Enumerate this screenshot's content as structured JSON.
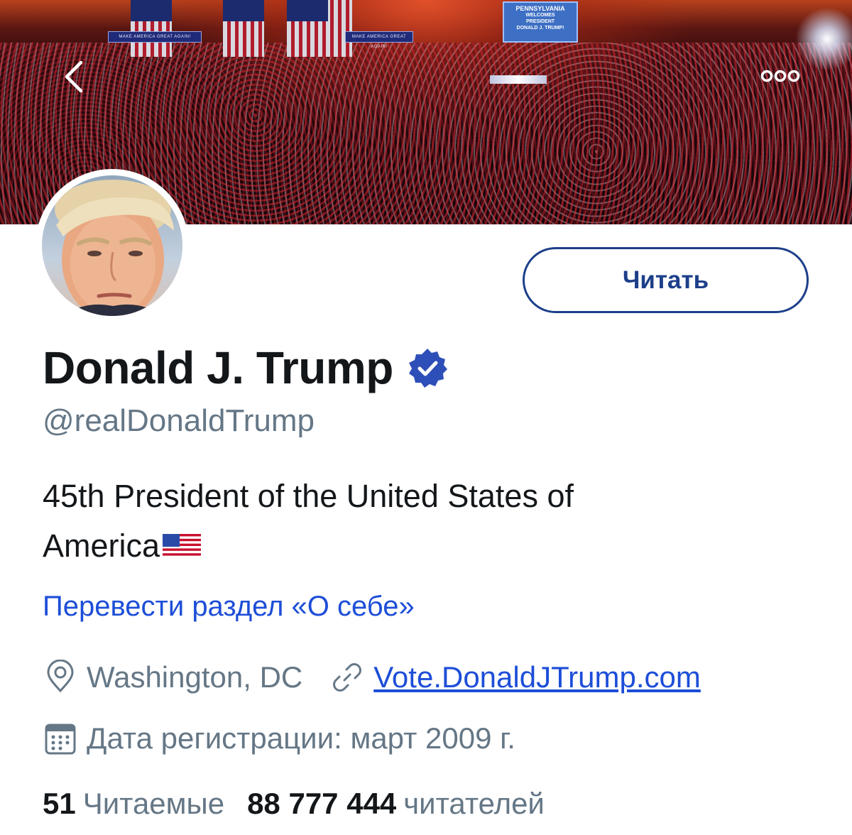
{
  "header": {
    "back_icon": "chevron-left-icon",
    "more_icon": "more-options-icon"
  },
  "banner": {
    "sign_left": "MAKE AMERICA GREAT AGAIN!",
    "sign_mid": "MAKE AMERICA GREAT AGAIN!",
    "screen_line1": "PENNSYLVANIA",
    "screen_line2": "WELCOMES",
    "screen_line3": "PRESIDENT",
    "screen_line4": "DONALD J. TRUMP!"
  },
  "profile": {
    "follow_label": "Читать",
    "display_name": "Donald J. Trump",
    "verified_icon": "verified-badge-icon",
    "handle": "@realDonaldTrump",
    "bio_line1": "45th President of the United States of",
    "bio_line2": "America",
    "translate_label": "Перевести раздел «О себе»",
    "location": "Washington, DC",
    "website": "Vote.DonaldJTrump.com",
    "joined": "Дата регистрации: март 2009 г.",
    "following_count": "51",
    "following_label": "Читаемые",
    "followers_count": "88 777 444",
    "followers_label": "читателей"
  },
  "colors": {
    "accent": "#1d4ed8",
    "button_border": "#1d3f8a",
    "verified": "#2f4fb8",
    "muted": "#657786",
    "text": "#14171a"
  }
}
